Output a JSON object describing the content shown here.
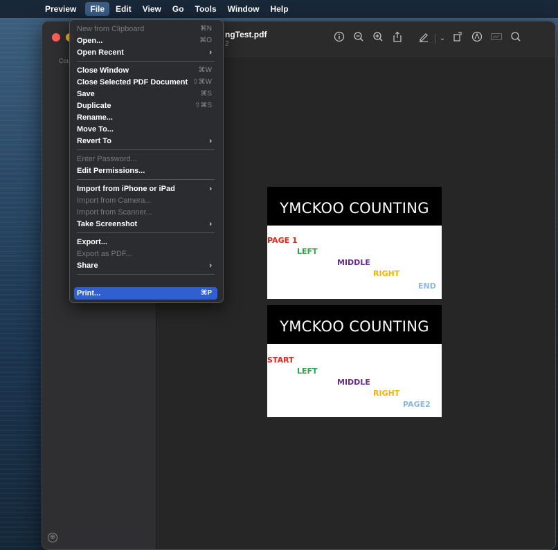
{
  "menubar": {
    "apple": "",
    "app": "Preview",
    "items": [
      "File",
      "Edit",
      "View",
      "Go",
      "Tools",
      "Window",
      "Help"
    ]
  },
  "window": {
    "title": "ngTest.pdf",
    "subtitle": "2",
    "sidebar_label": "Cou",
    "add_icon": "⊕"
  },
  "toolbar": {
    "icons": [
      "info-icon",
      "zoom-out-icon",
      "zoom-in-icon",
      "share-icon",
      "markup-pen-icon",
      "chevron-down-icon",
      "rotate-icon",
      "markup-circle-icon",
      "sign-icon",
      "search-icon"
    ]
  },
  "pages": [
    {
      "header": "YMCKOO COUNTING",
      "labels": [
        {
          "text": "PAGE 1",
          "color": "#e1251b"
        },
        {
          "text": "LEFT",
          "color": "#2aa84a"
        },
        {
          "text": "MIDDLE",
          "color": "#6b2c91"
        },
        {
          "text": "RIGHT",
          "color": "#f6b400"
        },
        {
          "text": "END",
          "color": "#8bb7e0"
        }
      ]
    },
    {
      "header": "YMCKOO COUNTING",
      "labels": [
        {
          "text": "START",
          "color": "#e1251b"
        },
        {
          "text": "LEFT",
          "color": "#2aa84a"
        },
        {
          "text": "MIDDLE",
          "color": "#6b2c91"
        },
        {
          "text": "RIGHT",
          "color": "#f6b400"
        },
        {
          "text": "PAGE2",
          "color": "#8bb7e0"
        }
      ]
    }
  ],
  "file_menu": {
    "items": [
      {
        "label": "New from Clipboard",
        "shortcut": "⌘N",
        "disabled": true
      },
      {
        "label": "Open...",
        "shortcut": "⌘O"
      },
      {
        "label": "Open Recent",
        "submenu": true
      },
      {
        "sep": true
      },
      {
        "label": "Close Window",
        "shortcut": "⌘W"
      },
      {
        "label": "Close Selected PDF Document",
        "shortcut": "⇧⌘W"
      },
      {
        "label": "Save",
        "shortcut": "⌘S"
      },
      {
        "label": "Duplicate",
        "shortcut": "⇧⌘S"
      },
      {
        "label": "Rename..."
      },
      {
        "label": "Move To..."
      },
      {
        "label": "Revert To",
        "submenu": true
      },
      {
        "sep": true
      },
      {
        "label": "Enter Password...",
        "disabled": true
      },
      {
        "label": "Edit Permissions..."
      },
      {
        "sep": true
      },
      {
        "label": "Import from iPhone or iPad",
        "submenu": true
      },
      {
        "label": "Import from Camera...",
        "disabled": true
      },
      {
        "label": "Import from Scanner...",
        "disabled": true
      },
      {
        "label": "Take Screenshot",
        "submenu": true
      },
      {
        "sep": true
      },
      {
        "label": "Export..."
      },
      {
        "label": "Export as PDF...",
        "disabled": true
      },
      {
        "label": "Share",
        "submenu": true
      },
      {
        "sep": true
      },
      {
        "label": "Print...",
        "shortcut": "⌘P",
        "highlight": true
      }
    ]
  }
}
